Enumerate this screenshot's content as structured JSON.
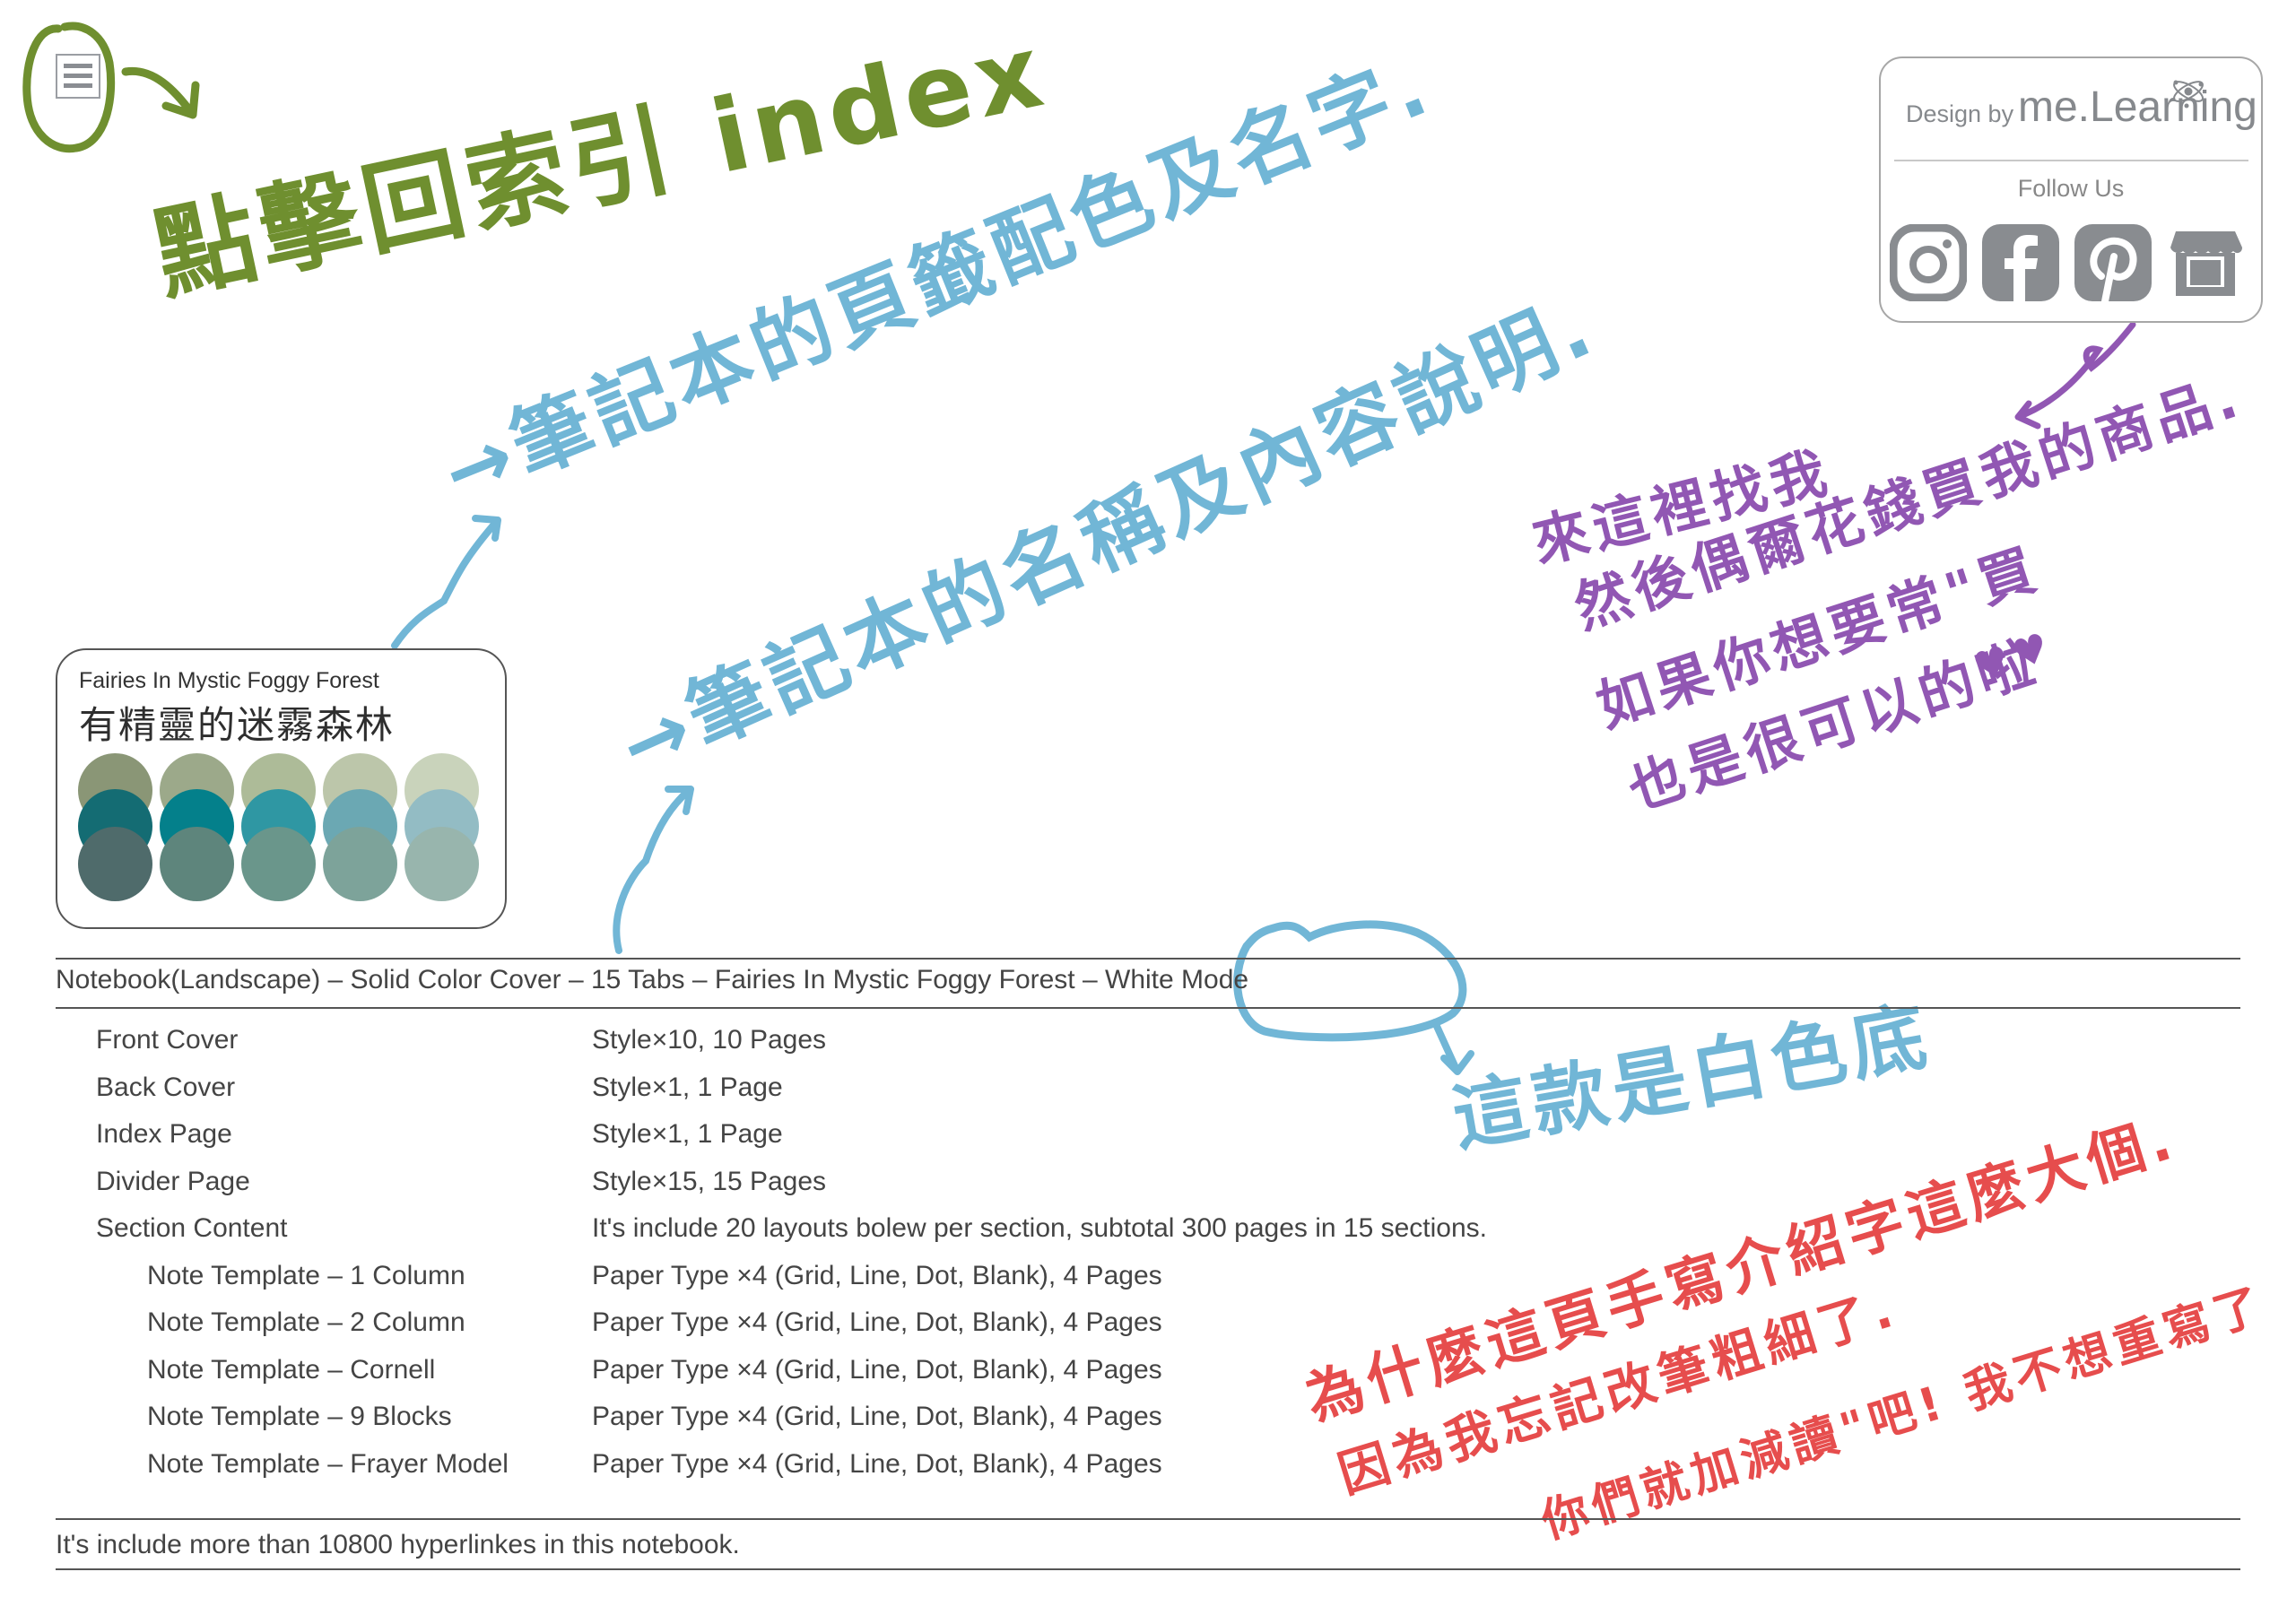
{
  "index_button": {
    "icon": "menu-index-icon"
  },
  "annotations": {
    "green_index": "點擊回索引 index",
    "blue_tab_colors": "→筆記本的頁籤配色及名字.",
    "blue_name_desc": "→筆記本的名稱及內容說明.",
    "blue_white_mode": "這款是白色底",
    "purple_shop": [
      "來這裡找我",
      "然後偶爾花錢買我的商品.",
      "如果你想要常\"買",
      "也是很可以的啦"
    ],
    "red_note": [
      "為什麼這頁手寫介紹字這麼大個.",
      "因為我忘記改筆粗細了.",
      "你們就加減讀\"吧! 我不想重寫了"
    ],
    "hearts": "♥♥"
  },
  "brand_box": {
    "design_by": "Design by",
    "brand_name": "me.Learning",
    "follow_us": "Follow Us",
    "social_icons": [
      "instagram-icon",
      "facebook-icon",
      "pinterest-icon",
      "shop-icon"
    ],
    "icon_color": "#898c90"
  },
  "palette": {
    "name_en": "Fairies In Mystic Foggy Forest",
    "name_zh": "有精靈的迷霧森林",
    "rows": [
      [
        "#8a9676",
        "#9ca98a",
        "#adbb98",
        "#bcc6aa",
        "#c9d3bb"
      ],
      [
        "#146c73",
        "#04808b",
        "#2f97a3",
        "#6ba8b3",
        "#93bcc4"
      ],
      [
        "#4f6b6b",
        "#5e857c",
        "#6a968b",
        "#7da39a",
        "#98b5ad"
      ]
    ]
  },
  "spec": {
    "title": "Notebook(Landscape) – Solid Color Cover – 15 Tabs – Fairies In Mystic Foggy Forest – White Mode",
    "rows": [
      {
        "label": "Front Cover",
        "value": "Style×10, 10 Pages",
        "indent": false
      },
      {
        "label": "Back Cover",
        "value": "Style×1, 1 Page",
        "indent": false
      },
      {
        "label": "Index Page",
        "value": "Style×1, 1 Page",
        "indent": false
      },
      {
        "label": "Divider Page",
        "value": "Style×15, 15 Pages",
        "indent": false
      },
      {
        "label": "Section Content",
        "value": "It's include 20 layouts bolew per section, subtotal 300 pages in 15 sections.",
        "indent": false
      },
      {
        "label": "Note Template – 1 Column",
        "value": "Paper Type ×4 (Grid, Line, Dot, Blank), 4 Pages",
        "indent": true
      },
      {
        "label": "Note Template – 2 Column",
        "value": "Paper Type ×4 (Grid, Line, Dot, Blank), 4 Pages",
        "indent": true
      },
      {
        "label": "Note Template – Cornell",
        "value": "Paper Type ×4 (Grid, Line, Dot, Blank), 4 Pages",
        "indent": true
      },
      {
        "label": "Note Template – 9 Blocks",
        "value": "Paper Type ×4 (Grid, Line, Dot, Blank), 4 Pages",
        "indent": true
      },
      {
        "label": "Note Template – Frayer Model",
        "value": "Paper Type ×4 (Grid, Line, Dot, Blank), 4 Pages",
        "indent": true
      }
    ],
    "footer": "It's include more than 10800 hyperlinkes in this notebook."
  }
}
